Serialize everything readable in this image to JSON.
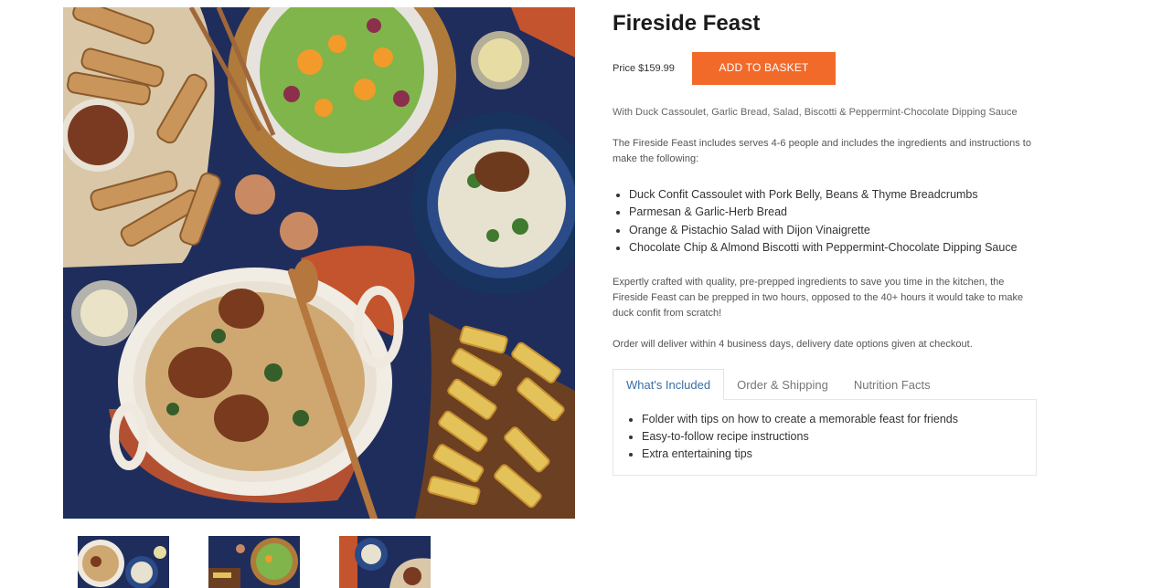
{
  "product": {
    "title": "Fireside Feast",
    "price": "Price $159.99",
    "add_to_basket_label": "ADD TO BASKET",
    "subtitle": "With Duck Cassoulet, Garlic Bread, Salad, Biscotti & Peppermint-Chocolate Dipping Sauce",
    "intro": "The Fireside Feast includes serves 4-6 people and includes the ingredients and instructions to make the following:",
    "menu_items": [
      "Duck Confit Cassoulet with Pork Belly, Beans & Thyme Breadcrumbs",
      "Parmesan & Garlic-Herb Bread",
      "Orange & Pistachio Salad with Dijon Vinaigrette",
      "Chocolate Chip & Almond Biscotti with Peppermint-Chocolate Dipping Sauce"
    ],
    "description": "Expertly crafted with quality, pre-prepped ingredients to save you time in the kitchen, the Fireside Feast can be prepped in two hours, opposed to the 40+ hours it would take to make duck confit from scratch!",
    "delivery_note": "Order will deliver within 4 business days, delivery date options given at checkout."
  },
  "tabs": {
    "labels": [
      "What's Included",
      "Order & Shipping",
      "Nutrition Facts"
    ],
    "active_index": 0,
    "whats_included": [
      "Folder with tips on how to create a memorable feast for friends",
      "Easy-to-follow recipe instructions",
      "Extra entertaining tips"
    ]
  },
  "colors": {
    "accent_button": "#f26a2a",
    "active_tab_text": "#3a6ea5",
    "tablecloth": "#1f2d5c"
  }
}
